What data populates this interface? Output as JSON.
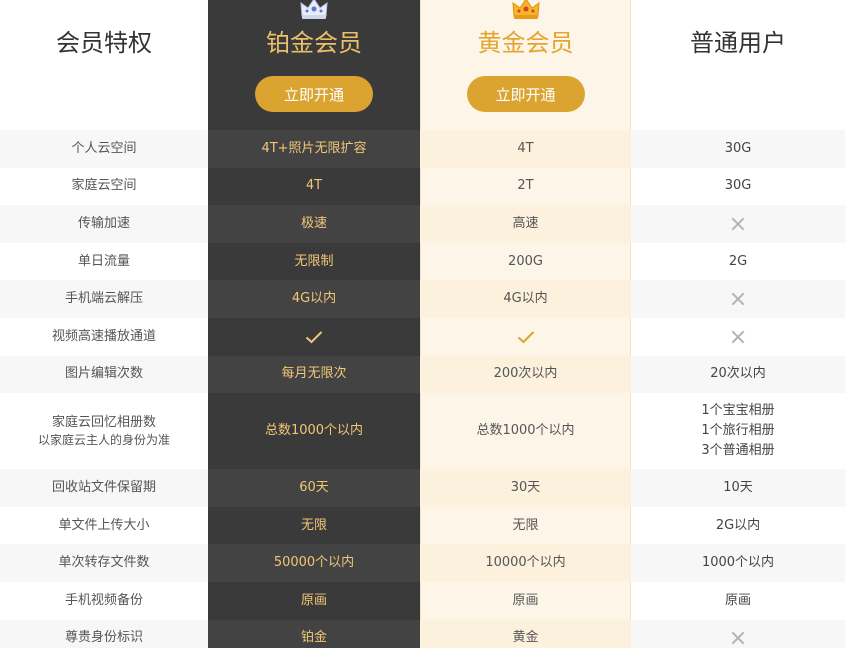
{
  "header": {
    "feature_title": "会员特权",
    "platinum_title": "铂金会员",
    "gold_title": "黄金会员",
    "normal_title": "普通用户",
    "platinum_button": "立即开通",
    "gold_button": "立即开通"
  },
  "colors": {
    "platinum_bg": "#3a3a3a",
    "platinum_text": "#f1c777",
    "gold_bg": "#fdf6e8",
    "gold_title": "#e4a42f",
    "button_bg": "#dba431",
    "cross": "#b3b3b3"
  },
  "rows": [
    {
      "feature": "个人云空间",
      "platinum": "4T+照片无限扩容",
      "gold": "4T",
      "normal": "30G"
    },
    {
      "feature": "家庭云空间",
      "platinum": "4T",
      "gold": "2T",
      "normal": "30G"
    },
    {
      "feature": "传输加速",
      "platinum": "极速",
      "gold": "高速",
      "normal": "cross-icon"
    },
    {
      "feature": "单日流量",
      "platinum": "无限制",
      "gold": "200G",
      "normal": "2G"
    },
    {
      "feature": "手机端云解压",
      "platinum": "4G以内",
      "gold": "4G以内",
      "normal": "cross-icon"
    },
    {
      "feature": "视频高速播放通道",
      "platinum": "check-icon",
      "gold": "check-icon",
      "normal": "cross-icon"
    },
    {
      "feature": "图片编辑次数",
      "platinum": "每月无限次",
      "gold": "200次以内",
      "normal": "20次以内"
    },
    {
      "feature": "家庭云回忆相册数",
      "feature_sub": "以家庭云主人的身份为准",
      "platinum": "总数1000个以内",
      "gold": "总数1000个以内",
      "normal_lines": [
        "1个宝宝相册",
        "1个旅行相册",
        "3个普通相册"
      ]
    },
    {
      "feature": "回收站文件保留期",
      "platinum": "60天",
      "gold": "30天",
      "normal": "10天"
    },
    {
      "feature": "单文件上传大小",
      "platinum": "无限",
      "gold": "无限",
      "normal": "2G以内"
    },
    {
      "feature": "单次转存文件数",
      "platinum": "50000个以内",
      "gold": "10000个以内",
      "normal": "1000个以内"
    },
    {
      "feature": "手机视频备份",
      "platinum": "原画",
      "gold": "原画",
      "normal": "原画"
    },
    {
      "feature": "尊贵身份标识",
      "platinum": "铂金",
      "gold": "黄金",
      "normal": "cross-icon"
    }
  ]
}
